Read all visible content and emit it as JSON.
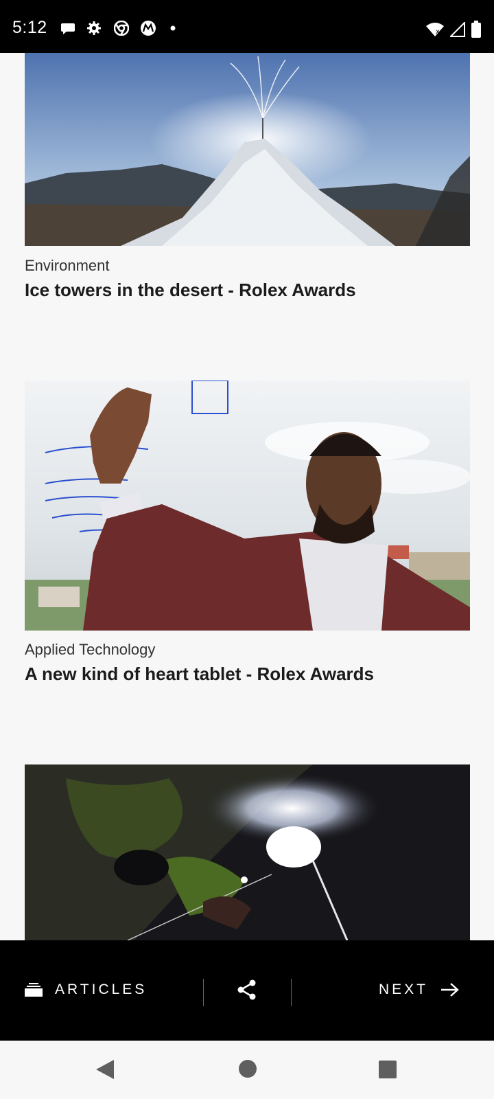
{
  "status_bar": {
    "time": "5:12",
    "icons": [
      "chat-icon",
      "settings-icon",
      "chrome-icon",
      "motorola-icon",
      "dot-icon"
    ],
    "right_icons": [
      "wifi-icon",
      "signal-icon",
      "battery-icon"
    ]
  },
  "articles": [
    {
      "category": "Environment",
      "title": "Ice towers in the desert - Rolex Awards"
    },
    {
      "category": "Applied Technology",
      "title": "A new kind of heart tablet - Rolex Awards"
    }
  ],
  "bottom_bar": {
    "articles_label": "ARTICLES",
    "next_label": "NEXT"
  },
  "nav_bar": {
    "back": "back-icon",
    "home": "home-icon",
    "recents": "recents-icon"
  }
}
